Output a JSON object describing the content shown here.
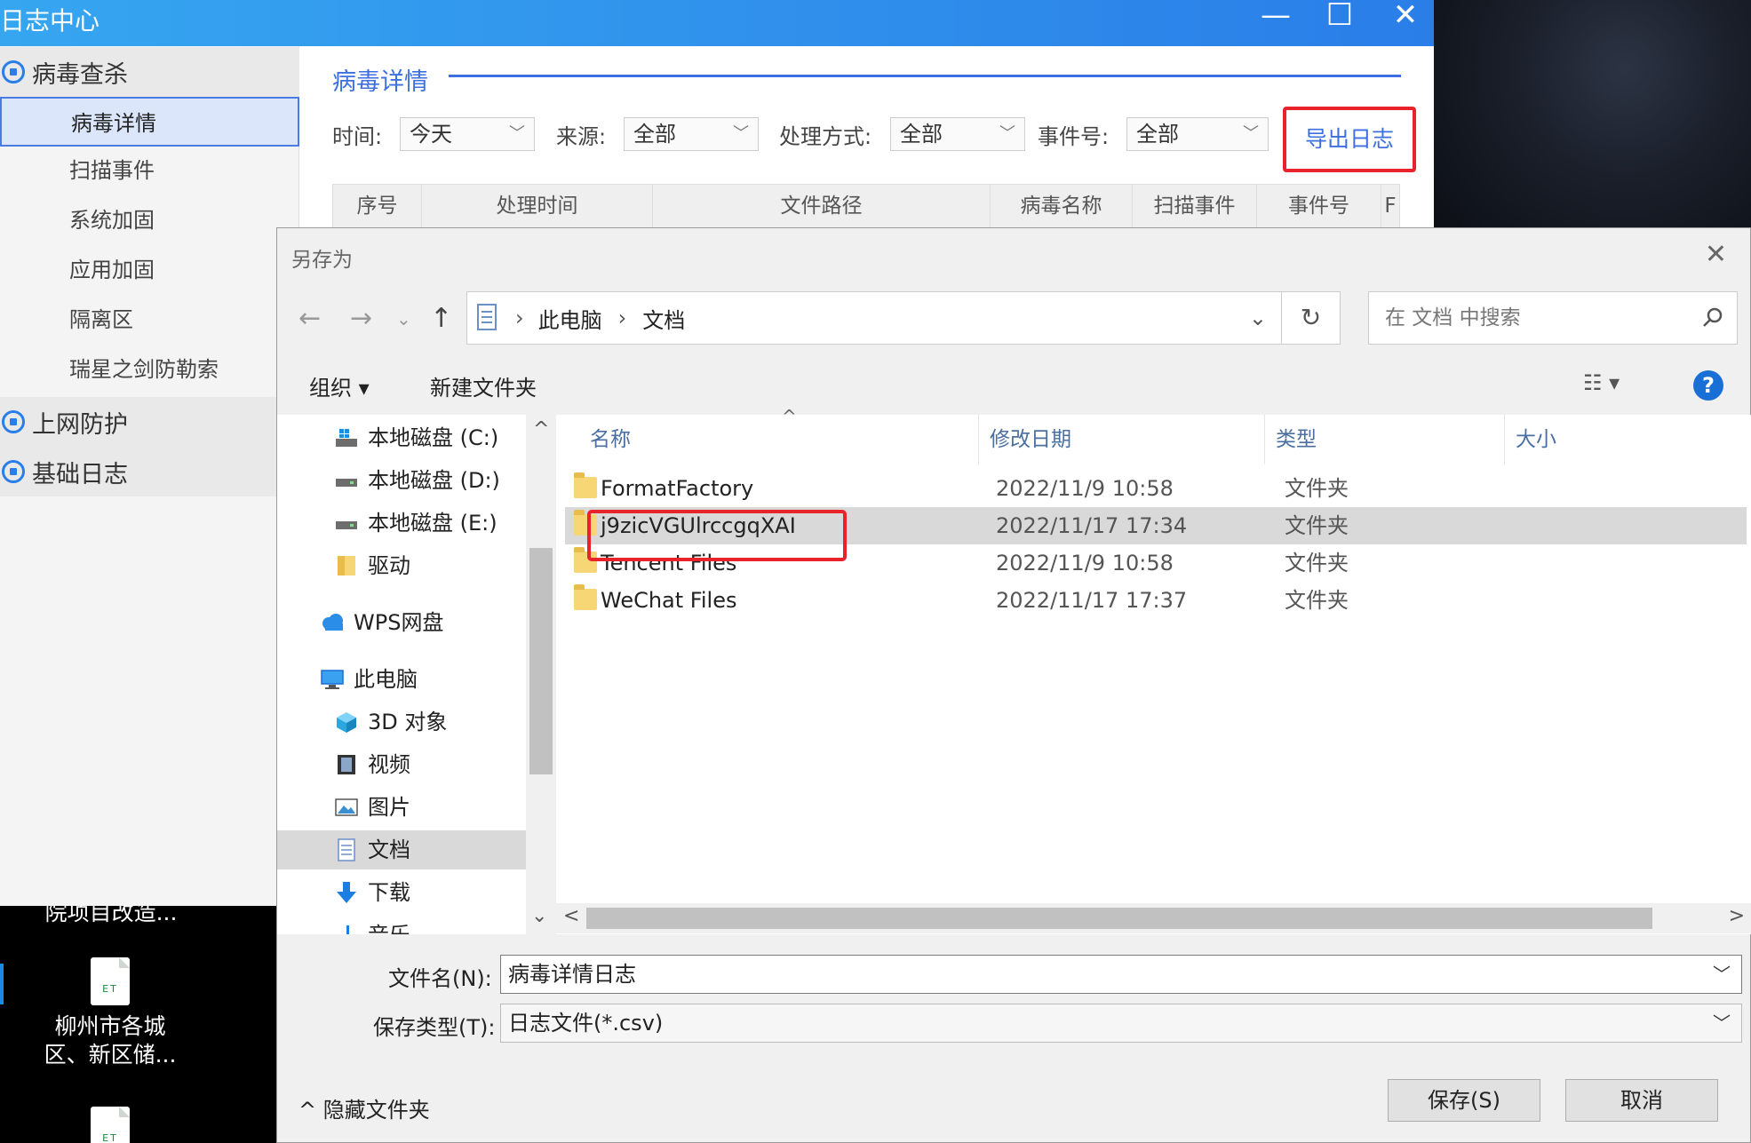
{
  "log_window": {
    "title": "日志中心",
    "controls": {
      "minimize": "—",
      "maximize": "☐",
      "close": "✕"
    },
    "sidebar": {
      "groups": [
        {
          "label": "病毒查杀"
        },
        {
          "label": "上网防护"
        },
        {
          "label": "基础日志"
        }
      ],
      "items": [
        "病毒详情",
        "扫描事件",
        "系统加固",
        "应用加固",
        "隔离区",
        "瑞星之剑防勒索"
      ]
    },
    "main": {
      "title": "病毒详情",
      "filters": {
        "time_label": "时间:",
        "time_value": "今天",
        "source_label": "来源:",
        "source_value": "全部",
        "method_label": "处理方式:",
        "method_value": "全部",
        "event_label": "事件号:",
        "event_value": "全部"
      },
      "export_button": "导出日志",
      "columns": [
        "序号",
        "处理时间",
        "文件路径",
        "病毒名称",
        "扫描事件",
        "事件号",
        "F"
      ]
    }
  },
  "desktop": {
    "icons": [
      {
        "label": "院项目改造..."
      },
      {
        "line1": "柳州市各城",
        "line2": "区、新区储...",
        "badge": "ET"
      },
      {
        "badge": "ET"
      }
    ]
  },
  "dialog": {
    "title": "另存为",
    "close": "✕",
    "nav": {
      "back": "←",
      "forward": "→",
      "recent": "⌄",
      "up": "↑"
    },
    "address": {
      "parts": [
        "此电脑",
        "文档"
      ],
      "sep": "›",
      "dropdown": "⌄",
      "refresh": "↻"
    },
    "search_placeholder": "在 文档 中搜索",
    "toolbar": {
      "organize": "组织 ▾",
      "new_folder": "新建文件夹",
      "view": "☷ ▾",
      "help": "?"
    },
    "tree": [
      {
        "label": "本地磁盘 (C:)",
        "icon": "drive-c-icon"
      },
      {
        "label": "本地磁盘 (D:)",
        "icon": "drive-icon"
      },
      {
        "label": "本地磁盘 (E:)",
        "icon": "drive-icon"
      },
      {
        "label": "驱动",
        "icon": "folder-icon"
      },
      {
        "label": "WPS网盘",
        "icon": "cloud-icon"
      },
      {
        "label": "此电脑",
        "icon": "computer-icon"
      },
      {
        "label": "3D 对象",
        "icon": "cube-icon"
      },
      {
        "label": "视频",
        "icon": "video-icon"
      },
      {
        "label": "图片",
        "icon": "picture-icon"
      },
      {
        "label": "文档",
        "icon": "document-icon"
      },
      {
        "label": "下载",
        "icon": "download-icon"
      },
      {
        "label": "音乐",
        "icon": "music-icon"
      }
    ],
    "tree_scroll": {
      "up": "^",
      "down": "⌄"
    },
    "columns": {
      "name": "名称",
      "date": "修改日期",
      "type": "类型",
      "size": "大小"
    },
    "sort_indicator": "^",
    "files": [
      {
        "name": "FormatFactory",
        "date": "2022/11/9 10:58",
        "type": "文件夹"
      },
      {
        "name": "j9zicVGUlrccgqXAI",
        "date": "2022/11/17 17:34",
        "type": "文件夹"
      },
      {
        "name": "Tencent Files",
        "date": "2022/11/9 10:58",
        "type": "文件夹"
      },
      {
        "name": "WeChat Files",
        "date": "2022/11/17 17:37",
        "type": "文件夹"
      }
    ],
    "hscroll": {
      "left": "<",
      "right": ">"
    },
    "filename_label": "文件名(N):",
    "filename_value": "病毒详情日志",
    "filetype_label": "保存类型(T):",
    "filetype_value": "日志文件(*.csv)",
    "hide_folders": "^  隐藏文件夹",
    "save_button": "保存(S)",
    "cancel_button": "取消",
    "colors": {
      "accent": "#2a7ee8",
      "highlight_border": "#e8232b"
    }
  }
}
